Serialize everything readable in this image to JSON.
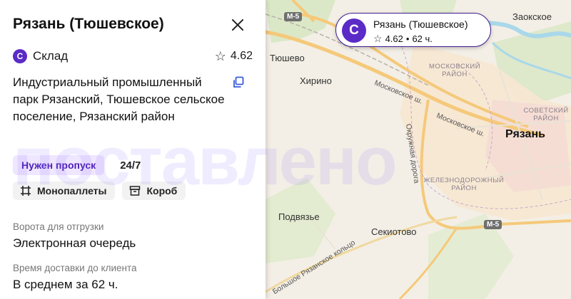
{
  "map": {
    "labels": {
      "ryazan": "Рязань",
      "tyushevo": "Тюшево",
      "khirino": "Хирино",
      "podvyazye": "Подвязье",
      "sekiotovo": "Секиотово",
      "zaokskoe": "Заокское",
      "moskovsky_district": "МОСКОВСКИЙ РАЙОН",
      "sovetsky_district": "СОВЕТСКИЙ РАЙОН",
      "zheleznodorozhny_district": "ЖЕЛЕЗНОДОРОЖНЫЙ РАЙОН",
      "moskovskoe_sh_1": "Московское ш.",
      "moskovskoe_sh_2": "Московское ш.",
      "okruzhnaya": "Окружная дорога",
      "bolshoe_ring": "Большое Рязанское кольцо",
      "m5_top": "М-5",
      "m5_bottom": "М-5"
    },
    "colors": {
      "background": "#f3efe6",
      "highway": "#f5c97a",
      "river": "#a8d8ea",
      "forest": "#cfe3b8"
    }
  },
  "panel": {
    "title": "Рязань (Тюшевское)",
    "logo_letter": "С",
    "type_label": "Склад",
    "rating": "4.62",
    "address": "Индустриальный промышленный парк Рязанский, Тюшевское сельское поселение, Рязанский район",
    "pass_chip": "Нужен пропуск",
    "hours": "24/7",
    "chip_monopallets": "Монопаллеты",
    "chip_box": "Короб",
    "gate_label": "Ворота для отгрузки",
    "gate_value": "Электронная очередь",
    "delivery_label": "Время доставки до клиента",
    "delivery_value": "В среднем за 62 ч."
  },
  "watermark": "поставлено",
  "pin": {
    "logo_letter": "С",
    "name": "Рязань (Тюшевское)",
    "rating": "4.62",
    "separator": "•",
    "hours": "62 ч."
  },
  "colors": {
    "accent": "#5b2bc7",
    "pass_chip_bg": "#efe6ff",
    "pass_chip_text": "#4d1fb8"
  },
  "icons": [
    "close-icon",
    "star-icon",
    "copy-icon",
    "pallet-icon",
    "box-icon"
  ]
}
